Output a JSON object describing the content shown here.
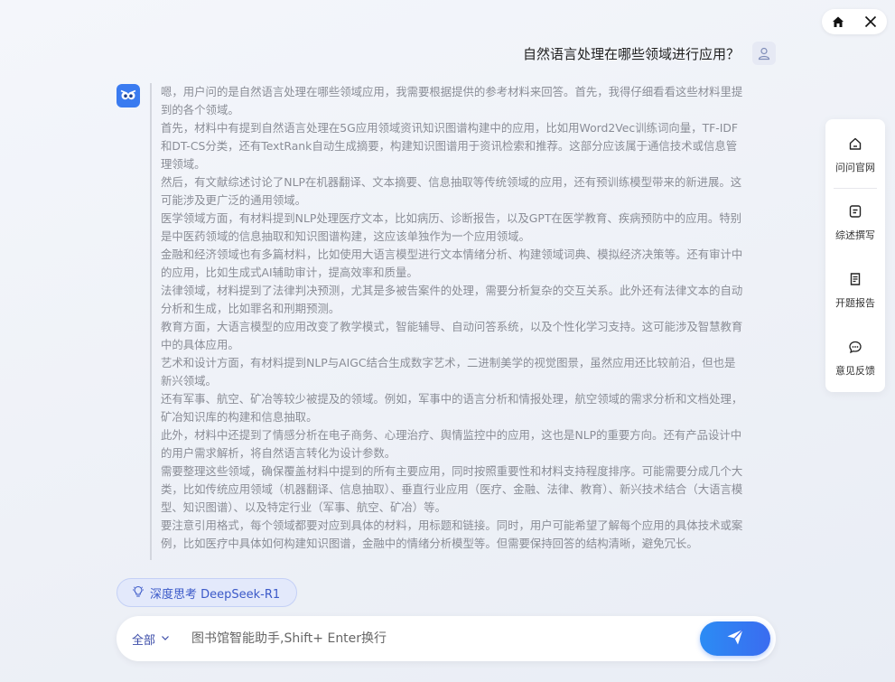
{
  "window_controls": {
    "home_icon": "home-icon",
    "close_icon": "close-icon"
  },
  "conversation": {
    "user_question": "自然语言处理在哪些领域进行应用？",
    "assistant_thinking": [
      "嗯，用户问的是自然语言处理在哪些领域应用，我需要根据提供的参考材料来回答。首先，我得仔细看看这些材料里提到的各个领域。",
      "首先，材料中有提到自然语言处理在5G应用领域资讯知识图谱构建中的应用，比如用Word2Vec训练词向量，TF-IDF和DT-CS分类，还有TextRank自动生成摘要，构建知识图谱用于资讯检索和推荐。这部分应该属于通信技术或信息管理领域。",
      "然后，有文献综述讨论了NLP在机器翻译、文本摘要、信息抽取等传统领域的应用，还有预训练模型带来的新进展。这可能涉及更广泛的通用领域。",
      "医学领域方面，有材料提到NLP处理医疗文本，比如病历、诊断报告，以及GPT在医学教育、疾病预防中的应用。特别是中医药领域的信息抽取和知识图谱构建，这应该单独作为一个应用领域。",
      "金融和经济领域也有多篇材料，比如使用大语言模型进行文本情绪分析、构建领域词典、模拟经济决策等。还有审计中的应用，比如生成式AI辅助审计，提高效率和质量。",
      "法律领域，材料提到了法律判决预测，尤其是多被告案件的处理，需要分析复杂的交互关系。此外还有法律文本的自动分析和生成，比如罪名和刑期预测。",
      "教育方面，大语言模型的应用改变了教学模式，智能辅导、自动问答系统，以及个性化学习支持。这可能涉及智慧教育中的具体应用。",
      "艺术和设计方面，有材料提到NLP与AIGC结合生成数字艺术，二进制美学的视觉图景，虽然应用还比较前沿，但也是新兴领域。",
      "还有军事、航空、矿冶等较少被提及的领域。例如，军事中的语言分析和情报处理，航空领域的需求分析和文档处理，矿冶知识库的构建和信息抽取。",
      "此外，材料中还提到了情感分析在电子商务、心理治疗、舆情监控中的应用，这也是NLP的重要方向。还有产品设计中的用户需求解析，将自然语言转化为设计参数。",
      "需要整理这些领域，确保覆盖材料中提到的所有主要应用，同时按照重要性和材料支持程度排序。可能需要分成几个大类，比如传统应用领域（机器翻译、信息抽取）、垂直行业应用（医疗、金融、法律、教育）、新兴技术结合（大语言模型、知识图谱）、以及特定行业（军事、航空、矿冶）等。",
      "要注意引用格式，每个领域都要对应到具体的材料，用标题和链接。同时，用户可能希望了解每个应用的具体技术或案例，比如医疗中具体如何构建知识图谱，金融中的情绪分析模型等。但需要保持回答的结构清晰，避免冗长。"
    ]
  },
  "sidebar": {
    "items": [
      {
        "label": "问问官网",
        "icon": "home-outline-icon"
      },
      {
        "label": "综述撰写",
        "icon": "document-icon"
      },
      {
        "label": "开题报告",
        "icon": "report-icon"
      },
      {
        "label": "意见反馈",
        "icon": "feedback-icon"
      }
    ]
  },
  "deep_think": {
    "label": "深度思考 DeepSeek-R1",
    "icon": "lightbulb-icon"
  },
  "input": {
    "scope_label": "全部",
    "placeholder": "图书馆智能助手,Shift+ Enter换行",
    "send_icon": "send-icon"
  },
  "colors": {
    "accent": "#3a6cf0",
    "chip_bg": "#e3e9fb",
    "thinking_text": "#8a8d96"
  }
}
